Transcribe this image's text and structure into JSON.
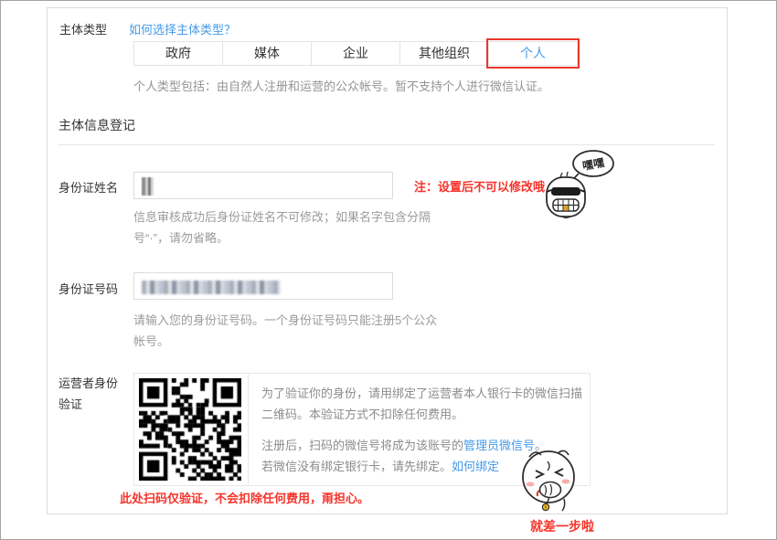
{
  "subject_type": {
    "label": "主体类型",
    "help_link": "如何选择主体类型？",
    "tabs": [
      "政府",
      "媒体",
      "企业",
      "其他组织",
      "个人"
    ],
    "selected": "个人",
    "description": "个人类型包括：由自然人注册和运营的公众帐号。暂不支持个人进行微信认证。"
  },
  "registration": {
    "section_title": "主体信息登记",
    "id_name": {
      "label": "身份证姓名",
      "note": "注：设置后不可以修改哦",
      "help_line1": "信息审核成功后身份证姓名不可修改；如果名字包含分隔",
      "help_line2": "号“·”，请勿省略。"
    },
    "id_number": {
      "label": "身份证号码",
      "help_line1": "请输入您的身份证号码。一个身份证号码只能注册5个公众",
      "help_line2": "帐号。"
    },
    "operator": {
      "label_line1": "运营者身份",
      "label_line2": "验证",
      "para1_line1": "为了验证你的身份，请用绑定了运营者本人银行卡的微信扫描",
      "para1_line2": "二维码。本验证方式不扣除任何费用。",
      "para2_text": "注册后，扫码的微信号将成为该账号的",
      "para2_link": "管理员微信号",
      "para2_period": "。",
      "para3_text": "若微信没有绑定银行卡，请先绑定。",
      "para3_link": "如何绑定",
      "caption": "此处扫码仅验证，不会扣除任何费用，甭担心。"
    }
  },
  "stickers": {
    "hehe_bubble": "嘿嘿"
  },
  "footer": {
    "note": "就差一步啦"
  },
  "colors": {
    "link": "#459ae9",
    "red": "#f5342b",
    "tab_highlight": "#e8382c"
  }
}
